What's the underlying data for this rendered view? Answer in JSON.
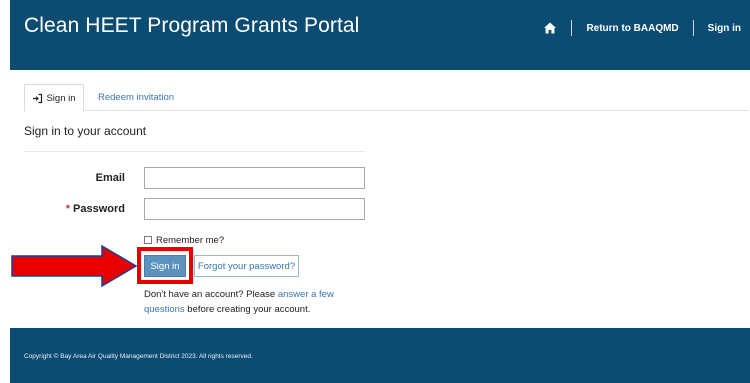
{
  "header": {
    "title": "Clean HEET Program Grants Portal",
    "nav": {
      "home_icon": "home-icon",
      "return_label": "Return to BAAQMD",
      "signin_label": "Sign in"
    }
  },
  "tabs": [
    {
      "label": "Sign in",
      "icon": "sign-in-icon",
      "active": true
    },
    {
      "label": "Redeem invitation",
      "active": false
    }
  ],
  "form": {
    "heading": "Sign in to your account",
    "email": {
      "label": "Email",
      "value": "",
      "placeholder": ""
    },
    "password": {
      "required_marker": "*",
      "label": "Password",
      "value": "",
      "placeholder": ""
    },
    "remember_label": "Remember me?",
    "remember_checked": false,
    "signin_button": "Sign in",
    "forgot_button": "Forgot your password?",
    "signup": {
      "prefix": "Don't have an account? Please ",
      "link": "answer a few questions",
      "suffix": " before creating your account."
    }
  },
  "annotation": {
    "arrow_color": "#e60000",
    "box_color": "#e60000"
  },
  "footer": {
    "copyright": "Copyright © Bay Area Air Quality Management District 2023. All rights reserved."
  },
  "colors": {
    "brand": "#0c4c73",
    "link": "#3a75b0",
    "primary_button": "#5c92bf"
  }
}
